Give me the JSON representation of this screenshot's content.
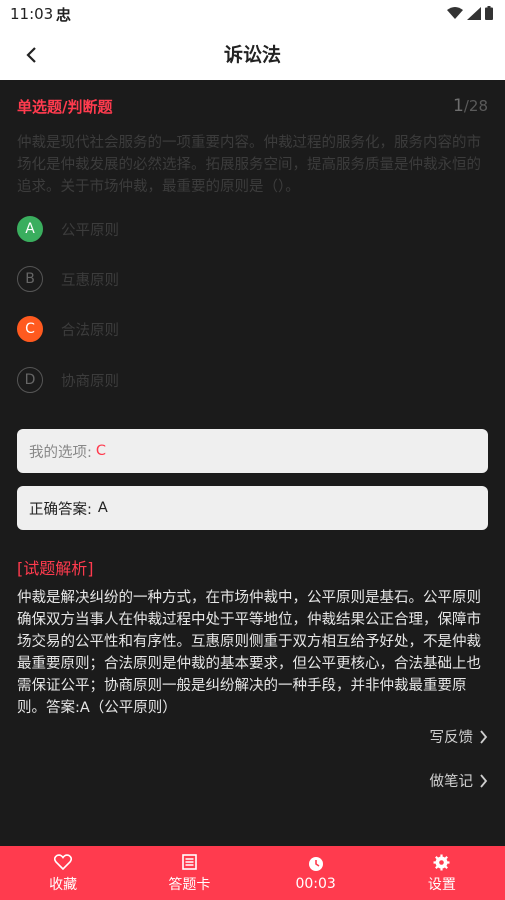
{
  "status": {
    "time": "11:03",
    "app_glyph": "忠"
  },
  "header": {
    "title": "诉讼法"
  },
  "question": {
    "type_label": "单选题/判断题",
    "progress_current": "1",
    "progress_total": "/28",
    "text": "仲裁是现代社会服务的一项重要内容。仲裁过程的服务化，服务内容的市场化是仲裁发展的必然选择。拓展服务空间，提高服务质量是仲裁永恒的追求。关于市场仲裁，最重要的原则是（）。",
    "options": [
      {
        "letter": "A",
        "text": "公平原则",
        "state": "correct"
      },
      {
        "letter": "B",
        "text": "互惠原则",
        "state": "normal"
      },
      {
        "letter": "C",
        "text": "合法原则",
        "state": "wrong"
      },
      {
        "letter": "D",
        "text": "协商原则",
        "state": "normal"
      }
    ]
  },
  "my_choice": {
    "label": "我的选项:",
    "value": "C"
  },
  "correct_answer": {
    "label": "正确答案:",
    "value": "A"
  },
  "analysis": {
    "title": "[试题解析]",
    "text": "仲裁是解决纠纷的一种方式，在市场仲裁中，公平原则是基石。公平原则确保双方当事人在仲裁过程中处于平等地位，仲裁结果公正合理，保障市场交易的公平性和有序性。互惠原则侧重于双方相互给予好处，不是仲裁最重要原则；合法原则是仲裁的基本要求，但公平更核心，合法基础上也需保证公平；协商原则一般是纠纷解决的一种手段，并非仲裁最重要原则。答案:A（公平原则）"
  },
  "links": {
    "feedback": "写反馈",
    "notes": "做笔记"
  },
  "bottom_bar": {
    "favorite": "收藏",
    "answer_card": "答题卡",
    "timer": "00:03",
    "settings": "设置"
  },
  "colors": {
    "accent": "#ff3b4e",
    "correct": "#3aae5e",
    "wrong": "#ff5a1f"
  }
}
